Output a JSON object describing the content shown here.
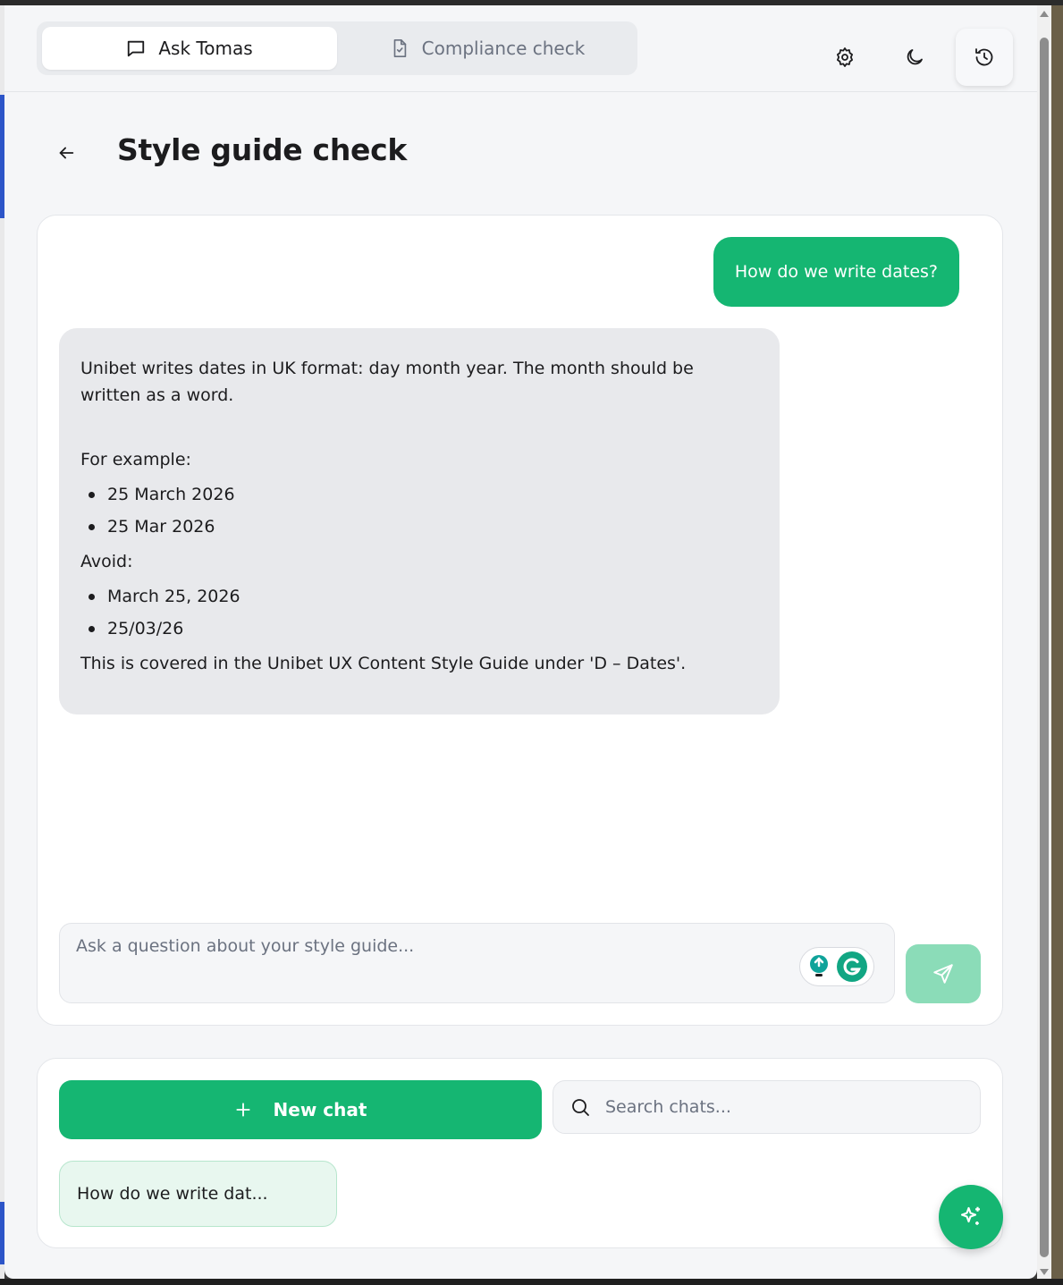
{
  "header": {
    "tabs": [
      {
        "label": "Ask Tomas",
        "icon": "chat-bubble-icon",
        "active": true
      },
      {
        "label": "Compliance check",
        "icon": "document-check-icon",
        "active": false
      }
    ],
    "actions": [
      "gear-icon",
      "moon-icon",
      "history-icon"
    ]
  },
  "page": {
    "title": "Style guide check"
  },
  "chat": {
    "user_message": "How do we write dates?",
    "assistant": {
      "intro": "Unibet writes dates in UK format: day month year. The month should be written as a word.",
      "example_label": "For example:",
      "examples": [
        "25 March 2026",
        "25 Mar 2026"
      ],
      "avoid_label": "Avoid:",
      "avoid": [
        "March 25, 2026",
        "25/03/26"
      ],
      "reference": "This is covered in the Unibet UX Content Style Guide under 'D – Dates'."
    },
    "input_placeholder": "Ask a question about your style guide..."
  },
  "history": {
    "new_chat_label": "New chat",
    "search_placeholder": "Search chats...",
    "items": [
      "How do we write dat..."
    ]
  },
  "colors": {
    "accent": "#15b672",
    "accent_light": "#8bdcb8",
    "bubble_grey": "#e8e9ec",
    "history_item_bg": "#e8f7ef"
  }
}
